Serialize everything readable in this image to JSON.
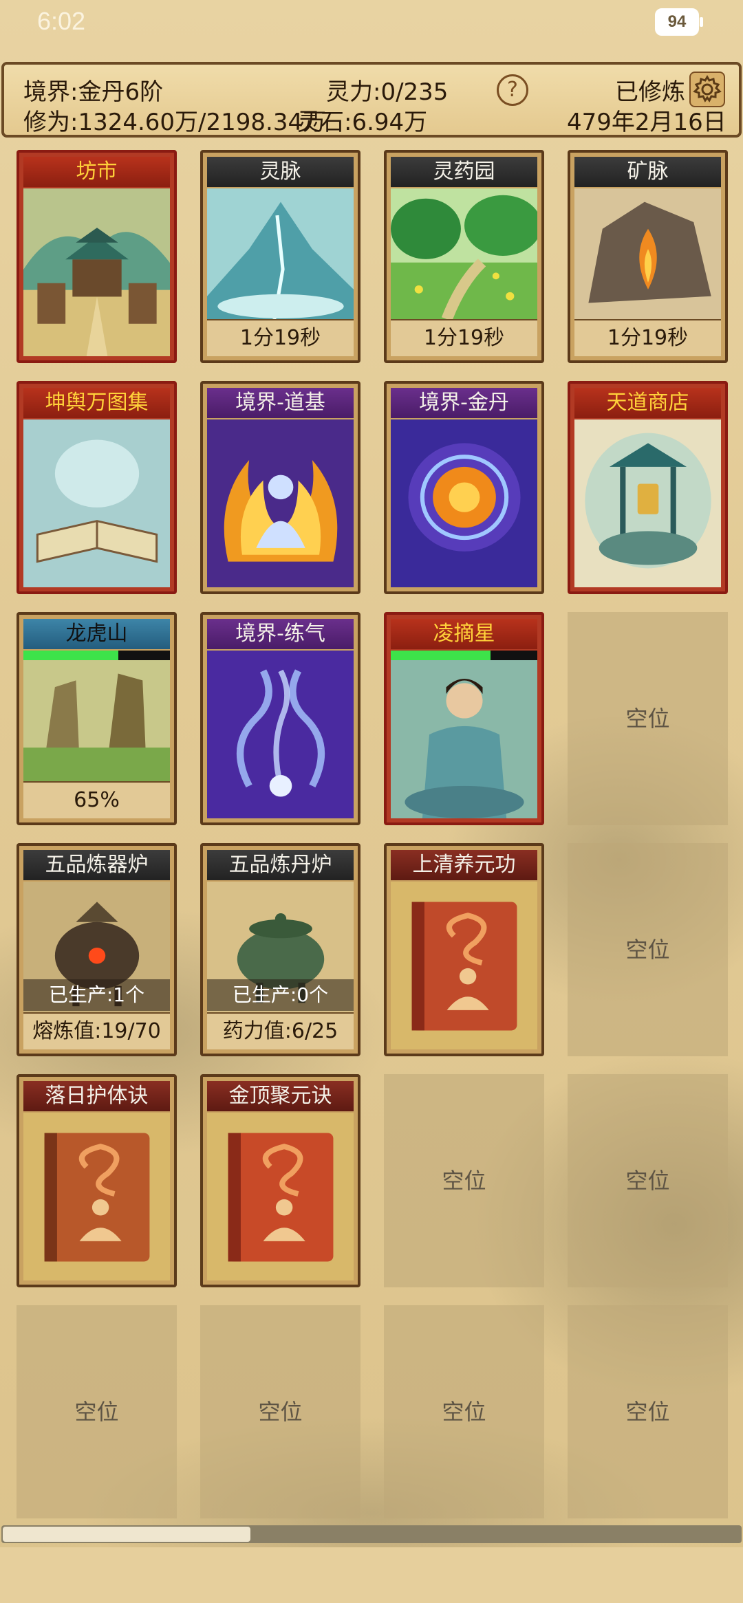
{
  "status_bar": {
    "time": "6:02",
    "battery": "94"
  },
  "header": {
    "realm": "境界:金丹6阶",
    "spirit_power": "灵力:0/235",
    "cultivation_status": "已修炼",
    "cultivation": "修为:1324.60万/2198.34万",
    "spirit_stones": "灵石:6.94万",
    "date": "479年2月16日",
    "help_icon": "?"
  },
  "cards": {
    "fangshi": {
      "title": "坊市"
    },
    "lingmai": {
      "title": "灵脉",
      "footer": "1分19秒"
    },
    "lingyaoyuan": {
      "title": "灵药园",
      "footer": "1分19秒"
    },
    "kuangmai": {
      "title": "矿脉",
      "footer": "1分19秒"
    },
    "kunyu": {
      "title": "坤舆万图集"
    },
    "realm_daoji": {
      "title": "境界-道基"
    },
    "realm_jindan": {
      "title": "境界-金丹"
    },
    "tiandao_shop": {
      "title": "天道商店"
    },
    "longhushan": {
      "title": "龙虎山",
      "footer": "65%",
      "progress": 0.65
    },
    "realm_lianqi": {
      "title": "境界-练气"
    },
    "lingzhaixing": {
      "title": "凌摘星",
      "hp": 0.68
    },
    "forge": {
      "title": "五品炼器炉",
      "produced": "已生产:1个",
      "footer": "熔炼值:19/70"
    },
    "alchemy": {
      "title": "五品炼丹炉",
      "produced": "已生产:0个",
      "footer": "药力值:6/25"
    },
    "shangqing": {
      "title": "上清养元功"
    },
    "luori": {
      "title": "落日护体诀"
    },
    "jinding": {
      "title": "金顶聚元诀"
    }
  },
  "empty_slot_label": "空位",
  "colors": {
    "background": "#e6cf9c",
    "card_border_brown": "#5b3a1a",
    "card_border_red": "#8a1b12",
    "title_gold": "#ffd23a",
    "hp_green": "#3de34a"
  },
  "icons": {
    "help": "question-circle-icon",
    "settings": "gear-icon"
  }
}
